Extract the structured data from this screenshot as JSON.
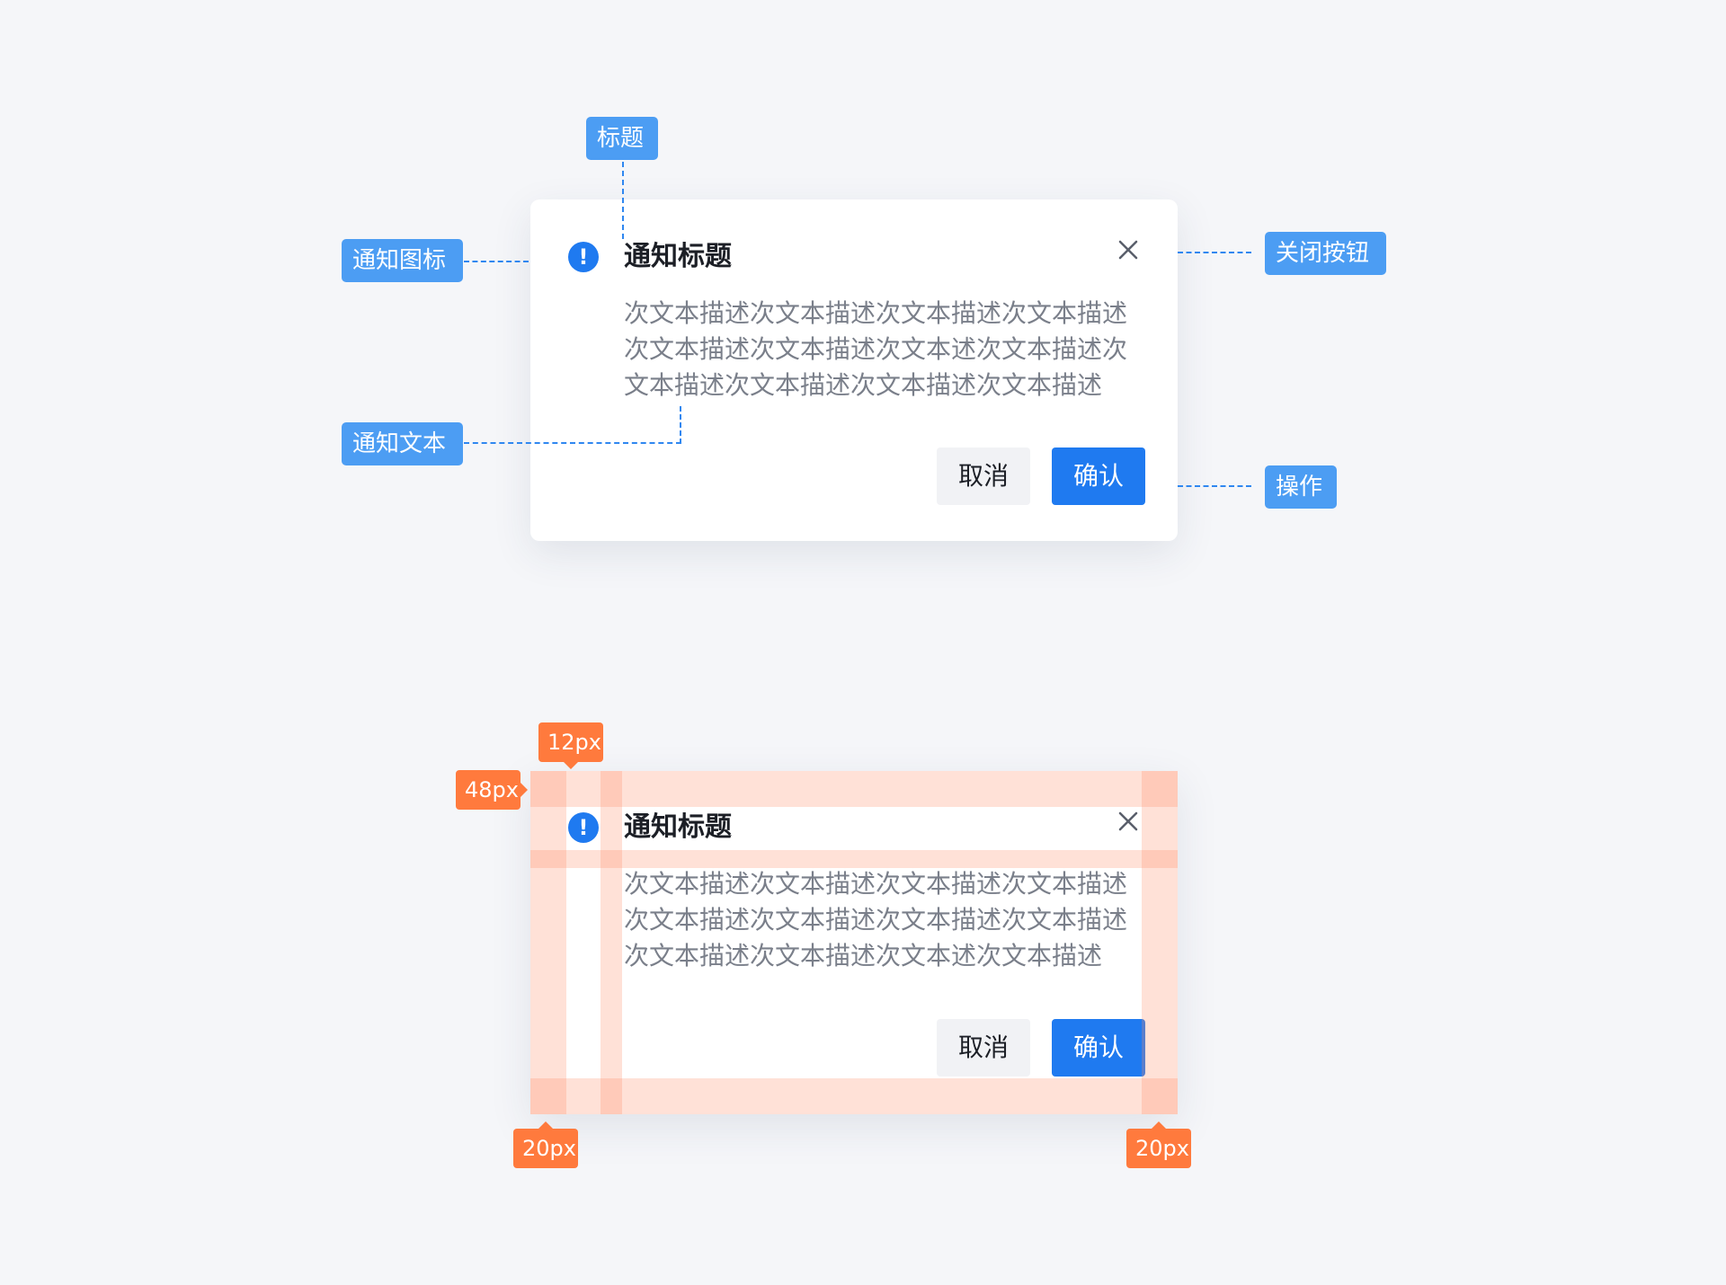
{
  "annotations": {
    "title": "标题",
    "icon": "通知图标",
    "close": "关闭按钮",
    "text": "通知文本",
    "actions": "操作"
  },
  "dialog": {
    "title": "通知标题",
    "icon_glyph": "!",
    "body_lines_1": [
      "次文本描述次文本描述次文本描述次文本描述",
      "次文本描述次文本描述次文本述次文本描述次",
      "文本描述次文本描述次文本描述次文本描述"
    ],
    "body_lines_2": [
      "次文本描述次文本描述次文本描述次文本描述",
      "次文本描述次文本描述次文本描述次文本描述",
      "次文本描述次文本描述次文本述次文本描述"
    ],
    "cancel_label": "取消",
    "confirm_label": "确认"
  },
  "spacing": {
    "top_label": "12px",
    "left_label": "48px",
    "bottom_left_label": "20px",
    "bottom_right_label": "20px"
  },
  "colors": {
    "background": "#F5F6F9",
    "primary": "#1F7AF0",
    "annotation": "#4C9DF3",
    "spacing_tag": "#FF7A3D",
    "spacing_overlay": "#FFD9CC"
  },
  "icons": {
    "notice": "exclamation-circle-icon",
    "close": "close-icon"
  }
}
